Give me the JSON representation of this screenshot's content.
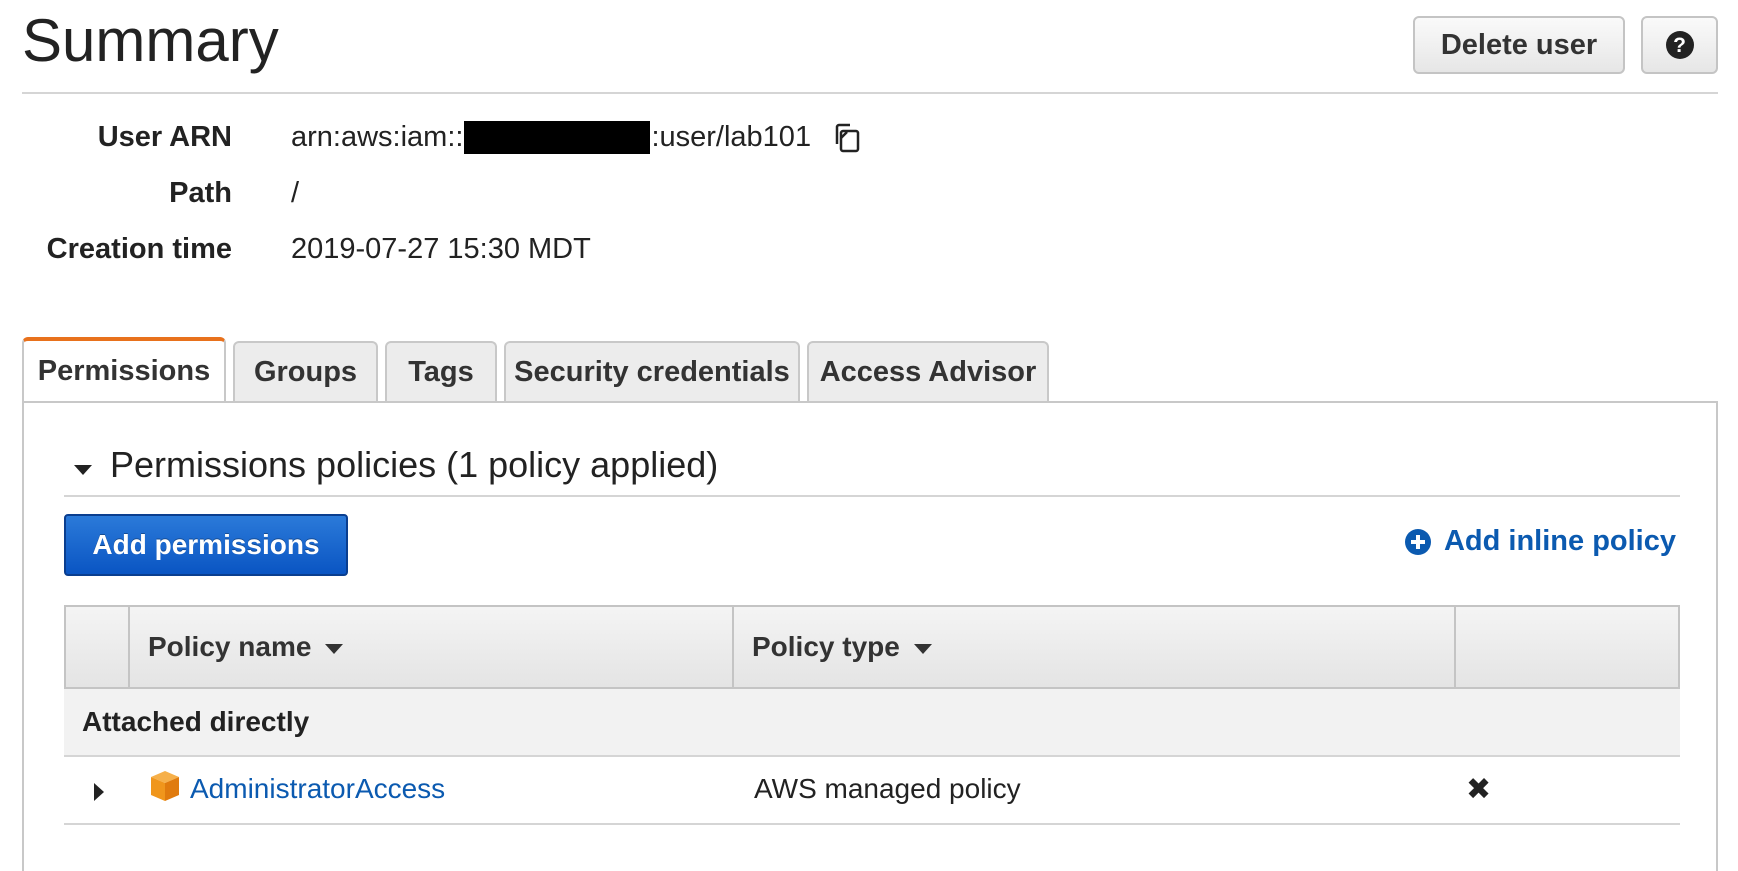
{
  "header": {
    "title": "Summary",
    "delete_user_label": "Delete user",
    "help_icon": "?"
  },
  "info": {
    "user_arn": {
      "label": "User ARN",
      "prefix": "arn:aws:iam::",
      "suffix": ":user/lab101"
    },
    "path": {
      "label": "Path",
      "value": "/"
    },
    "creation_time": {
      "label": "Creation time",
      "value": "2019-07-27 15:30 MDT"
    }
  },
  "tabs": [
    {
      "label": "Permissions",
      "active": true
    },
    {
      "label": "Groups"
    },
    {
      "label": "Tags"
    },
    {
      "label": "Security credentials"
    },
    {
      "label": "Access Advisor"
    }
  ],
  "permissions": {
    "section_title": "Permissions policies (1 policy applied)",
    "add_permissions_label": "Add permissions",
    "add_inline_policy_label": "Add inline policy",
    "table": {
      "columns": [
        "Policy name",
        "Policy type"
      ],
      "groups": [
        {
          "label": "Attached directly",
          "rows": [
            {
              "name": "AdministratorAccess",
              "type": "AWS managed policy"
            }
          ]
        }
      ]
    }
  },
  "colors": {
    "accent_tab": "#e8711c",
    "primary_button": "#0a55c3",
    "link": "#0b5ab0"
  },
  "icons": {
    "copy": "copy-icon",
    "help": "help-icon",
    "add": "plus-circle-icon",
    "policy": "box-icon",
    "remove": "close-icon"
  }
}
